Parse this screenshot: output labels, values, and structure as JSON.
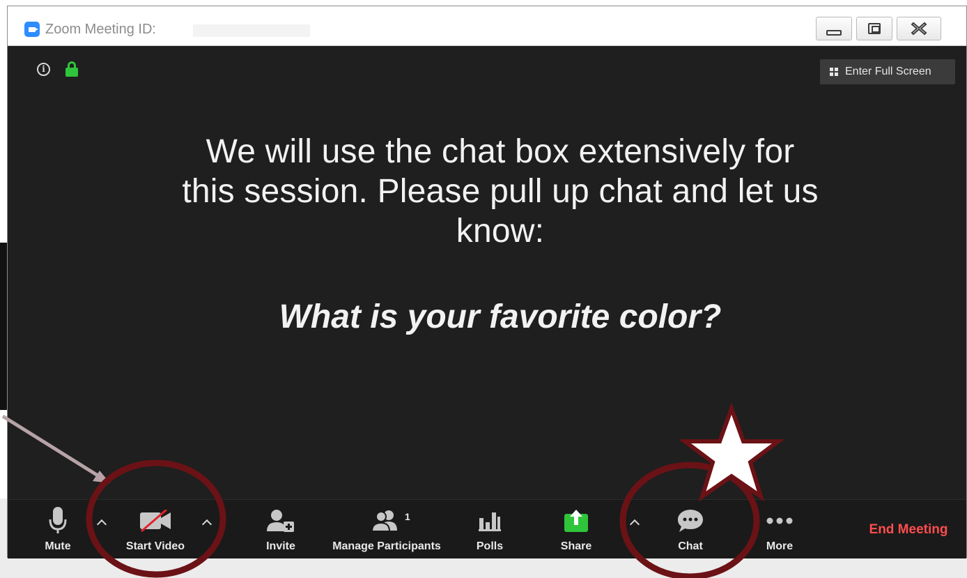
{
  "window": {
    "title": "Zoom Meeting ID:",
    "controls": {
      "minimize": "minimize",
      "maximize": "maximize",
      "close": "close"
    }
  },
  "header": {
    "fullscreen_label": "Enter Full Screen"
  },
  "message": {
    "line1": "We will use the chat box extensively for",
    "line2": "this session. Please pull up chat and let us",
    "line3": "know:",
    "question": "What is your favorite color?"
  },
  "toolbar": {
    "mute": "Mute",
    "start_video": "Start Video",
    "invite": "Invite",
    "manage_participants": "Manage Participants",
    "participants_count": "1",
    "polls": "Polls",
    "share": "Share",
    "chat": "Chat",
    "more": "More",
    "end_meeting": "End Meeting"
  },
  "colors": {
    "zoom_blue": "#2d8cff",
    "lock_green": "#2fc53a",
    "share_green": "#2fc53a",
    "end_red": "#ff4d4d",
    "annotation_maroon": "#6b1216",
    "arrow_mauve": "#b7a3a7"
  }
}
